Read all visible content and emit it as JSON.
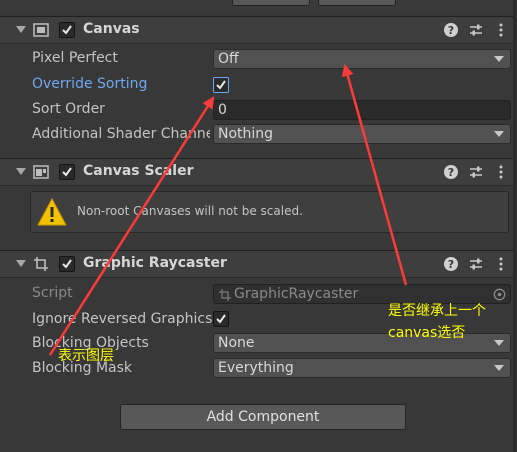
{
  "canvas": {
    "title": "Canvas",
    "properties": {
      "pixel_perfect": {
        "label": "Pixel Perfect",
        "value": "Off"
      },
      "override_sorting": {
        "label": "Override Sorting",
        "checked": true
      },
      "sort_order": {
        "label": "Sort Order",
        "value": "0"
      },
      "additional_shader_channels": {
        "label": "Additional Shader Channe",
        "value": "Nothing"
      }
    }
  },
  "canvas_scaler": {
    "title": "Canvas Scaler",
    "warning": "Non-root Canvases will not be scaled."
  },
  "graphic_raycaster": {
    "title": "Graphic Raycaster",
    "properties": {
      "script": {
        "label": "Script",
        "value": "GraphicRaycaster"
      },
      "ignore_reversed": {
        "label": "Ignore Reversed Graphics",
        "checked": true
      },
      "blocking_objects": {
        "label": "Blocking Objects",
        "value": "None"
      },
      "blocking_mask": {
        "label": "Blocking Mask",
        "value": "Everything"
      }
    }
  },
  "add_component_label": "Add Component",
  "annotations": {
    "layer_note": "表示图层",
    "inherit_note_line1": "是否继承上一个",
    "inherit_note_line2": "canvas选否"
  },
  "colors": {
    "annotation_text": "#ffff00",
    "annotation_arrow": "#ff3b3b",
    "override_label": "#6fa8f0",
    "panel_bg": "#383838"
  }
}
